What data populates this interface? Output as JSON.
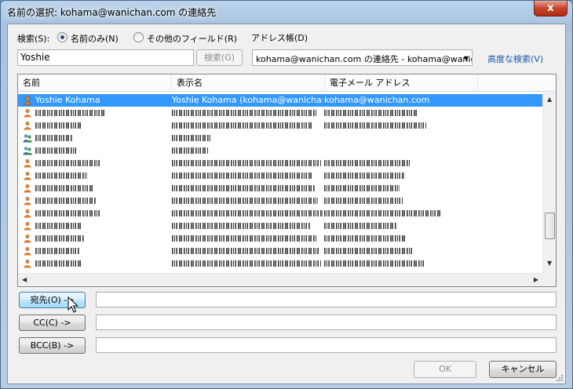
{
  "window": {
    "title": "名前の選択: kohama@wanichan.com の連絡先",
    "close_label": "x"
  },
  "search": {
    "label": "検索(S):",
    "mode_name_only": "名前のみ(N)",
    "mode_other_fields": "その他のフィールド(R)",
    "mode_selected": "name_only",
    "value": "Yoshie",
    "button_label": "検索(G)"
  },
  "address_book": {
    "label": "アドレス帳(D)",
    "selected": "kohama@wanichan.com の連絡先 - kohama@wanic",
    "advanced_link": "高度な検索(V)"
  },
  "list": {
    "columns": [
      "名前",
      "表示名",
      "電子メール アドレス"
    ],
    "selected_row": {
      "name": "Yoshie Kohama",
      "display_name": "Yoshie Kohama (kohama@wanichan...",
      "email": "kohama@wanichan.com",
      "icon": "person-icon"
    },
    "obscured_rows": [
      {
        "icon": "person-icon"
      },
      {
        "icon": "person-icon"
      },
      {
        "icon": "group-icon"
      },
      {
        "icon": "group-icon"
      },
      {
        "icon": "person-icon"
      },
      {
        "icon": "person-icon"
      },
      {
        "icon": "person-icon"
      },
      {
        "icon": "person-icon"
      },
      {
        "icon": "person-icon"
      },
      {
        "icon": "person-icon"
      },
      {
        "icon": "person-icon"
      },
      {
        "icon": "person-icon"
      },
      {
        "icon": "person-icon"
      },
      {
        "icon": "person-icon"
      }
    ]
  },
  "recipients": {
    "to_label": "宛先(O) ->",
    "cc_label": "CC(C) ->",
    "bcc_label": "BCC(B) ->",
    "to_value": "",
    "cc_value": "",
    "bcc_value": ""
  },
  "footer": {
    "ok_label": "OK",
    "cancel_label": "キャンセル"
  },
  "colors": {
    "selection": "#3399ff",
    "link": "#1e5aa8",
    "close_button": "#c7452c"
  }
}
